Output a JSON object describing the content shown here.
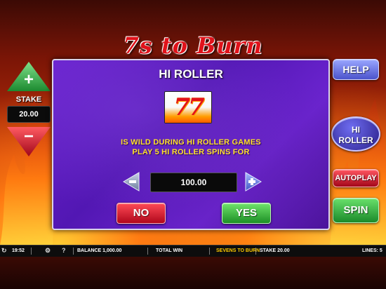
{
  "game": {
    "logo_text": "7s to Burn"
  },
  "left_panel": {
    "stake_label": "STAKE",
    "stake_value": "20.00",
    "plus_symbol": "+",
    "minus_symbol": "−"
  },
  "right_panel": {
    "help_label": "HELP",
    "hiroller_line1": "HI",
    "hiroller_line2": "ROLLER",
    "autoplay_label": "AUTOPLAY",
    "spin_label": "SPIN"
  },
  "dialog": {
    "title": "HI ROLLER",
    "symbol_text": "77",
    "line1": "IS WILD DURING HI ROLLER GAMES",
    "line2": "PLAY 5 HI ROLLER SPINS FOR",
    "value": "100.00",
    "no_label": "NO",
    "yes_label": "YES"
  },
  "status_bar": {
    "time": "19:52",
    "balance": "BALANCE  1,000.00",
    "total_win": "TOTAL WIN",
    "game_title": "SEVENS TO BURN",
    "stake": "STAKE  20.00",
    "lines": "LINES: 5"
  },
  "colors": {
    "dialog_purple": "#5a1bbf",
    "accent_yellow": "#ffe22a",
    "no_red": "#d01025",
    "yes_green": "#2aa83a",
    "help_blue": "#6a73e6"
  }
}
